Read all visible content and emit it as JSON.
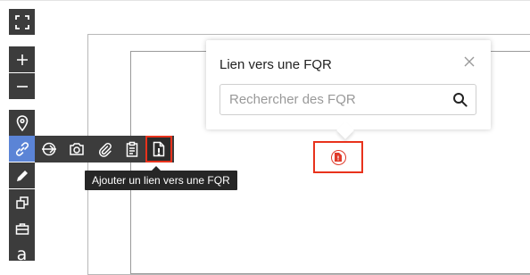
{
  "toolbar": {
    "items": [
      {
        "id": "fullscreen",
        "icon": "fullscreen-icon"
      },
      {
        "id": "zoom-in",
        "icon": "plus-icon"
      },
      {
        "id": "zoom-out",
        "icon": "minus-icon"
      },
      {
        "id": "location",
        "icon": "location-pin-icon"
      },
      {
        "id": "link",
        "icon": "link-icon",
        "active": true
      },
      {
        "id": "draw",
        "icon": "pencil-icon"
      },
      {
        "id": "shapes",
        "icon": "shapes-icon"
      },
      {
        "id": "equipment",
        "icon": "toolbox-icon"
      },
      {
        "id": "text",
        "icon": "text-icon",
        "label": "a"
      }
    ]
  },
  "submenu": {
    "items": [
      {
        "id": "direction",
        "icon": "direction-icon"
      },
      {
        "id": "photo",
        "icon": "camera-icon"
      },
      {
        "id": "attachment",
        "icon": "paperclip-icon"
      },
      {
        "id": "clipboard",
        "icon": "clipboard-icon"
      },
      {
        "id": "fqr-link",
        "icon": "fqr-document-icon",
        "highlighted": true
      }
    ],
    "tooltip": "Ajouter un lien vers une FQR"
  },
  "popup": {
    "title": "Lien vers une FQR",
    "search_placeholder": "Rechercher des FQR",
    "search_value": ""
  },
  "plan_pin": {
    "icon": "fqr-pin-icon"
  },
  "colors": {
    "toolbar_bg": "#3c3c3c",
    "active_blue": "#5b84d6",
    "highlight_red": "#e8321c",
    "tooltip_bg": "#262626"
  }
}
